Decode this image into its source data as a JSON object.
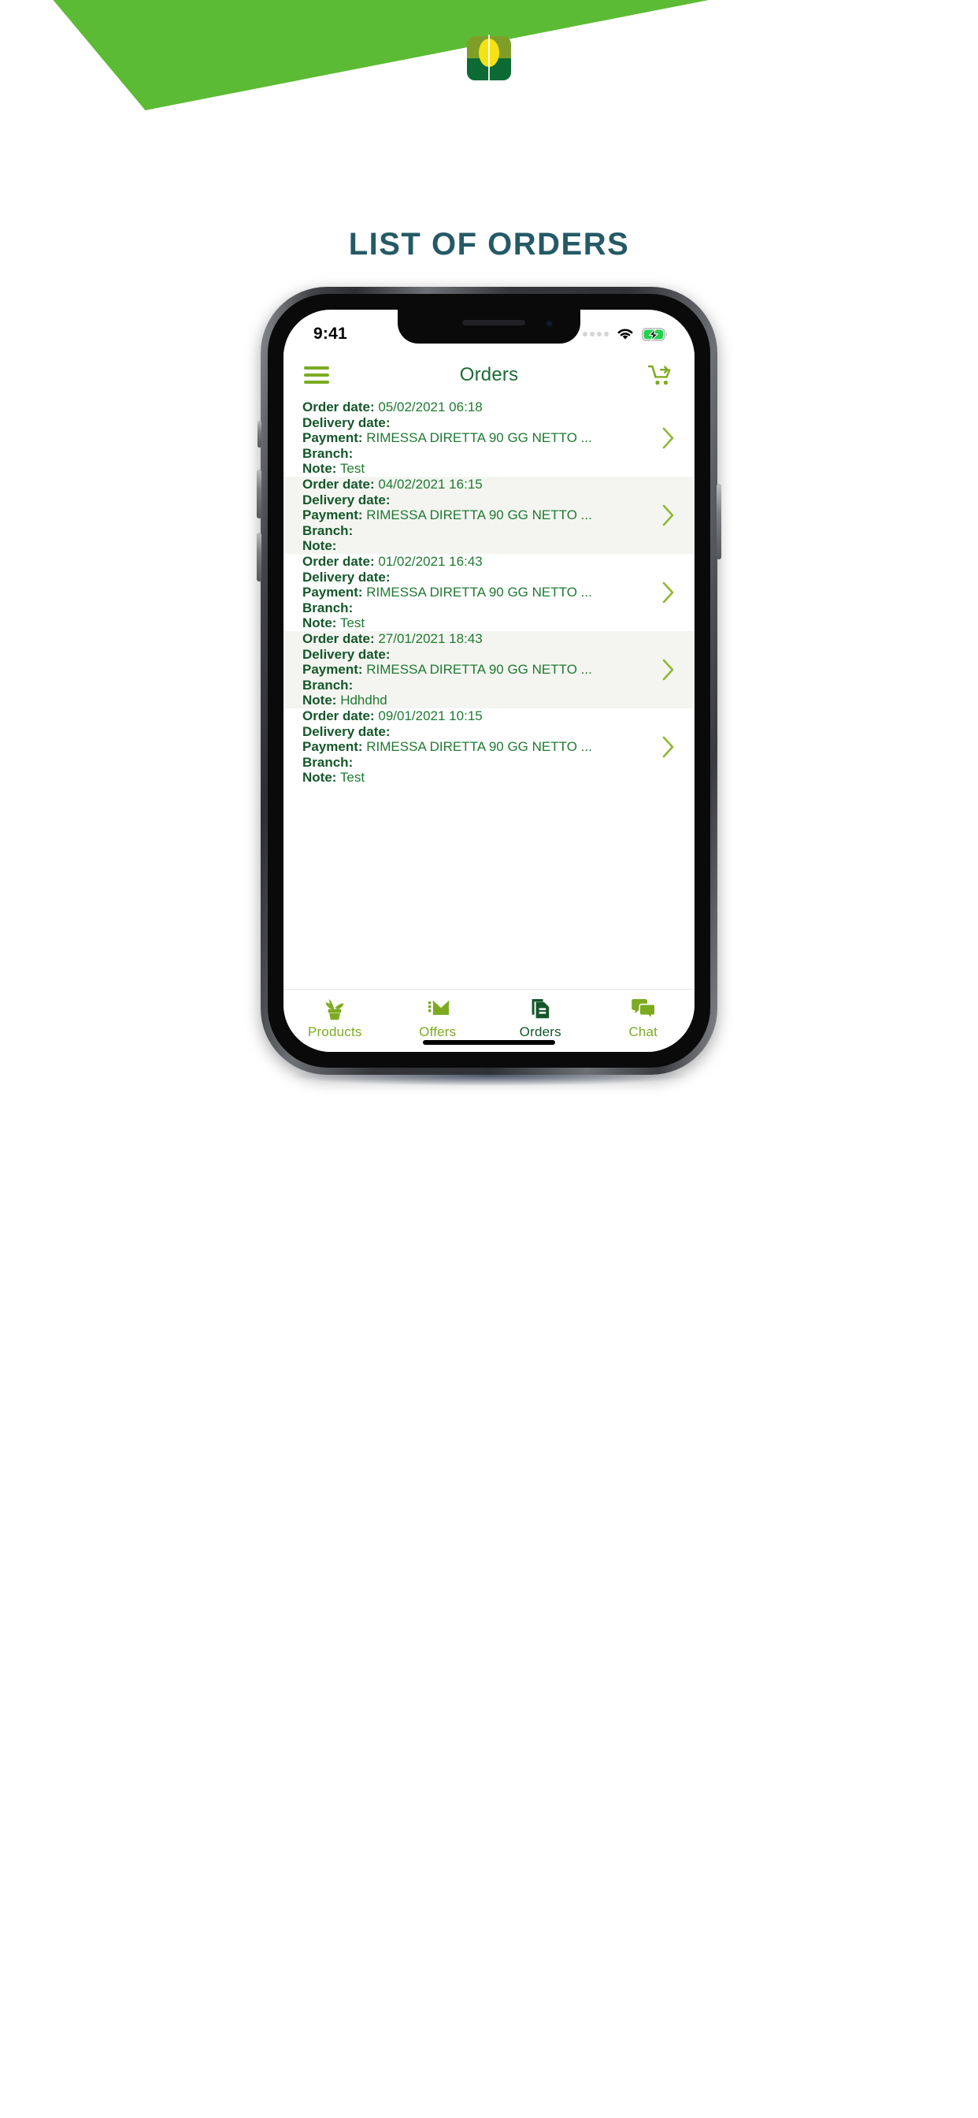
{
  "header": {
    "title": "LIST OF ORDERS",
    "title_color": "#245a66",
    "wedge_color": "#5cbb34",
    "logo_name": "corn-leaf-logo",
    "logo_colors": {
      "top": "#7f9e28",
      "seed": "#f5e214",
      "bottom": "#0c6b35"
    }
  },
  "phone": {
    "statusbar": {
      "time": "9:41",
      "signal_icon": "signal-dots-icon",
      "wifi_icon": "wifi-icon",
      "battery_icon": "battery-charging-icon",
      "battery_color": "#23d14b"
    },
    "appbar": {
      "menu_icon": "hamburger-menu-icon",
      "title": "Orders",
      "cart_icon": "add-to-cart-icon",
      "accent_color": "#7cab21",
      "title_color": "#1a6b33"
    },
    "labels": {
      "order_date": "Order date:",
      "delivery_date": "Delivery date:",
      "payment": "Payment:",
      "branch": "Branch:",
      "note": "Note:"
    },
    "orders": [
      {
        "order_date": "05/02/2021 06:18",
        "delivery_date": "",
        "payment": "RIMESSA DIRETTA 90 GG NETTO ...",
        "branch": "",
        "note": "Test"
      },
      {
        "order_date": "04/02/2021 16:15",
        "delivery_date": "",
        "payment": "RIMESSA DIRETTA 90 GG NETTO ...",
        "branch": "",
        "note": ""
      },
      {
        "order_date": "01/02/2021 16:43",
        "delivery_date": "",
        "payment": "RIMESSA DIRETTA 90 GG NETTO ...",
        "branch": "",
        "note": "Test"
      },
      {
        "order_date": "27/01/2021 18:43",
        "delivery_date": "",
        "payment": "RIMESSA DIRETTA 90 GG NETTO ...",
        "branch": "",
        "note": "Hdhdhd"
      },
      {
        "order_date": "09/01/2021 10:15",
        "delivery_date": "",
        "payment": "RIMESSA DIRETTA 90 GG NETTO ...",
        "branch": "",
        "note": "Test"
      }
    ],
    "tabs": [
      {
        "label": "Products",
        "icon": "potted-plant-icon",
        "active": false
      },
      {
        "label": "Offers",
        "icon": "envelope-icon",
        "active": false
      },
      {
        "label": "Orders",
        "icon": "documents-icon",
        "active": true
      },
      {
        "label": "Chat",
        "icon": "chat-bubbles-icon",
        "active": false
      }
    ]
  }
}
